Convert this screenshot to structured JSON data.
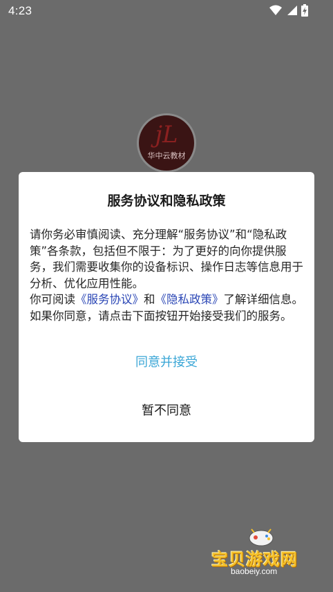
{
  "status_bar": {
    "time": "4:23",
    "icons": [
      "wifi-icon",
      "signal-icon",
      "battery-charging-icon"
    ]
  },
  "background_app": {
    "logo_glyph": "jL",
    "logo_text": "华中云教材"
  },
  "dialog": {
    "title": "服务协议和隐私政策",
    "paragraph1": "请你务必审慎阅读、充分理解“服务协议”和“隐私政策”各条款，包括但不限于：为了更好的向你提供服务，我们需要收集你的设备标识、操作日志等信息用于分析、优化应用性能。",
    "paragraph2_prefix": "你可阅读",
    "service_link": "《服务协议》",
    "paragraph2_and": "和",
    "privacy_link": "《隐私政策》",
    "paragraph2_suffix": "了解详细信息。如果你同意，请点击下面按钮开始接受我们的服务。",
    "accept_label": "同意并接受",
    "decline_label": "暂不同意"
  },
  "watermark": {
    "title": "宝贝游戏网",
    "url": "baobeiy.com"
  },
  "colors": {
    "overlay": "#6b6b6b",
    "accept": "#3aa6d6",
    "link": "#2a46b5"
  }
}
